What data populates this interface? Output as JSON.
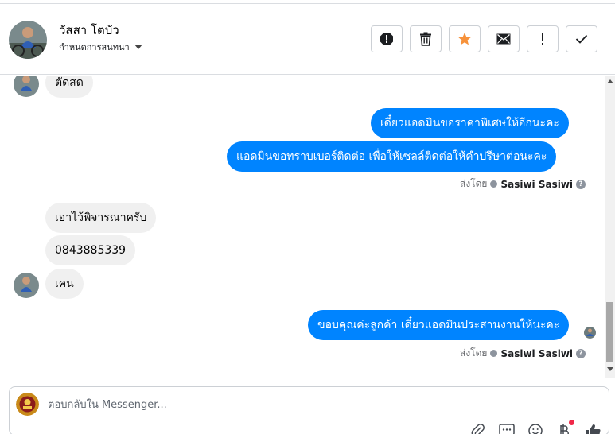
{
  "header": {
    "contact_name": "วัสสา โตบัว",
    "assign_label": "กำหนดการสนทนา"
  },
  "actions": [
    {
      "name": "spam-button",
      "icon": "exclamation-octagon-icon"
    },
    {
      "name": "delete-button",
      "icon": "trash-icon"
    },
    {
      "name": "star-button",
      "icon": "star-icon",
      "color": "#f7923b"
    },
    {
      "name": "mark-unread-button",
      "icon": "envelope-icon"
    },
    {
      "name": "follow-up-button",
      "icon": "exclamation-icon"
    },
    {
      "name": "done-button",
      "icon": "check-icon"
    }
  ],
  "messages": {
    "m1": "ตัดสด",
    "m2": "เดี๋ยวแอดมินขอราคาพิเศษให้อีกนะคะ",
    "m3": "แอดมินขอทราบเบอร์ติดต่อ เพื่อให้เซลล์ติดต่อให้คำปรึษาต่อนะคะ",
    "m4": "เอาไว้พิจารณาครับ",
    "m5": "0843885339",
    "m6": "เคน",
    "m7": "ขอบคุณค่ะลูกค้า เดี๋ยวแอดมินประสานงานให้นะคะ"
  },
  "sent_by": {
    "label": "ส่งโดย",
    "name": "Sasiwi Sasiwi",
    "help": "?"
  },
  "composer": {
    "placeholder": "ตอบกลับใน Messenger..."
  },
  "colors": {
    "outgoing": "#0084ff",
    "incoming": "#f0f0f0",
    "accent_star": "#f7923b"
  }
}
